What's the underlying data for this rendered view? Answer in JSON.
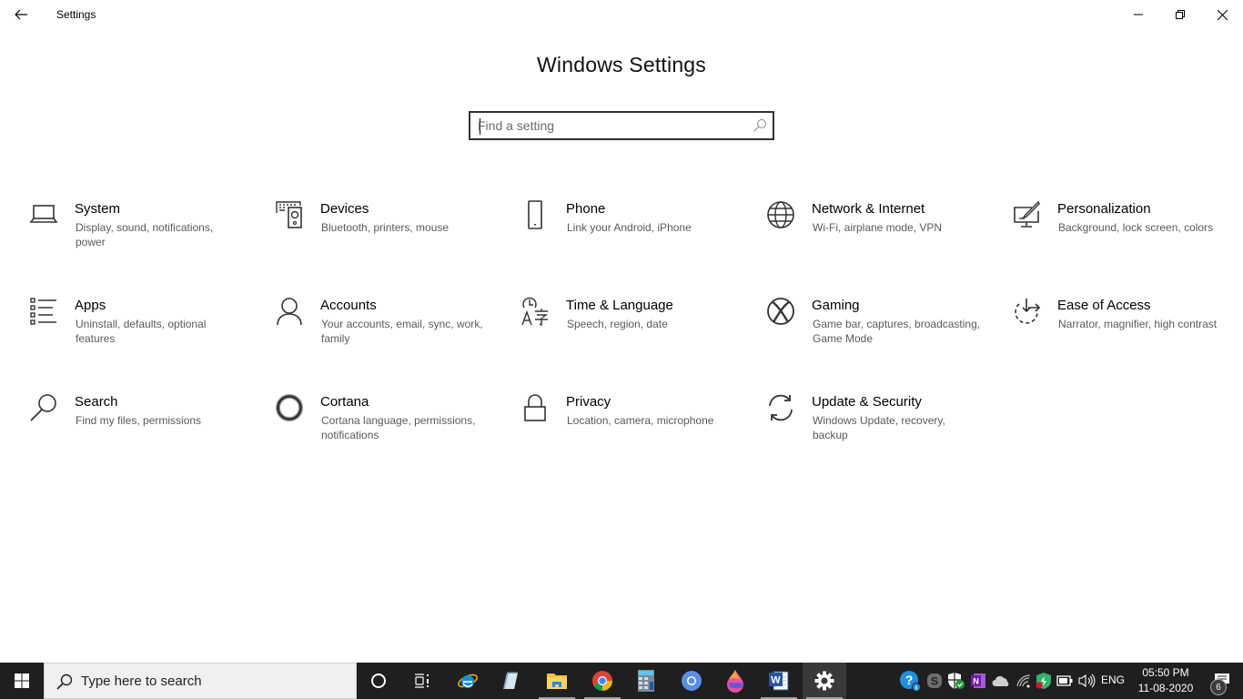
{
  "window": {
    "app_title": "Settings",
    "back_icon": "arrow-left-icon",
    "controls": {
      "minimize": "minimize-icon",
      "maximize": "restore-icon",
      "close": "close-icon"
    }
  },
  "main": {
    "title": "Windows Settings",
    "search": {
      "placeholder": "Find a setting",
      "value": "",
      "icon": "search-icon"
    },
    "tiles": [
      {
        "title": "System",
        "desc": "Display, sound, notifications, power",
        "icon": "laptop-icon"
      },
      {
        "title": "Devices",
        "desc": "Bluetooth, printers, mouse",
        "icon": "keyboard-speaker-icon"
      },
      {
        "title": "Phone",
        "desc": "Link your Android, iPhone",
        "icon": "phone-icon"
      },
      {
        "title": "Network & Internet",
        "desc": "Wi-Fi, airplane mode, VPN",
        "icon": "globe-icon"
      },
      {
        "title": "Personalization",
        "desc": "Background, lock screen, colors",
        "icon": "paint-brush-icon"
      },
      {
        "title": "Apps",
        "desc": "Uninstall, defaults, optional features",
        "icon": "apps-list-icon"
      },
      {
        "title": "Accounts",
        "desc": "Your accounts, email, sync, work, family",
        "icon": "person-icon"
      },
      {
        "title": "Time & Language",
        "desc": "Speech, region, date",
        "icon": "time-language-icon"
      },
      {
        "title": "Gaming",
        "desc": "Game bar, captures, broadcasting, Game Mode",
        "icon": "xbox-icon"
      },
      {
        "title": "Ease of Access",
        "desc": "Narrator, magnifier, high contrast",
        "icon": "ease-of-access-icon"
      },
      {
        "title": "Search",
        "desc": "Find my files, permissions",
        "icon": "magnifier-icon"
      },
      {
        "title": "Cortana",
        "desc": "Cortana language, permissions, notifications",
        "icon": "cortana-icon"
      },
      {
        "title": "Privacy",
        "desc": "Location, camera, microphone",
        "icon": "lock-icon"
      },
      {
        "title": "Update & Security",
        "desc": "Windows Update, recovery, backup",
        "icon": "sync-icon"
      }
    ]
  },
  "taskbar": {
    "search_placeholder": "Type here to search",
    "pinned": [
      {
        "name": "cortana",
        "icon": "cortana-circle-icon"
      },
      {
        "name": "task-view",
        "icon": "task-view-icon"
      },
      {
        "name": "internet-explorer",
        "icon": "internet-explorer-icon"
      },
      {
        "name": "notepad",
        "icon": "notepad-icon"
      },
      {
        "name": "file-explorer",
        "icon": "folder-icon"
      },
      {
        "name": "chrome",
        "icon": "chrome-icon"
      },
      {
        "name": "calculator",
        "icon": "calculator-icon"
      },
      {
        "name": "chromium",
        "icon": "chromium-icon"
      },
      {
        "name": "paint-3d",
        "icon": "paint-drop-icon"
      },
      {
        "name": "word",
        "icon": "word-icon"
      },
      {
        "name": "settings",
        "icon": "gear-icon"
      }
    ],
    "tray": {
      "icons": [
        "help-icon",
        "skype-icon",
        "security-shield-icon",
        "onenote-icon",
        "onedrive-icon",
        "wifi-icon",
        "defender-icon",
        "battery-icon",
        "volume-icon"
      ],
      "language": "ENG",
      "time": "05:50 PM",
      "date": "11-08-2020",
      "notification_count": "6"
    }
  },
  "colors": {
    "taskbar_bg": "#201f1f",
    "icon_stroke": "#333333",
    "desc_text": "#5a5a5a"
  }
}
